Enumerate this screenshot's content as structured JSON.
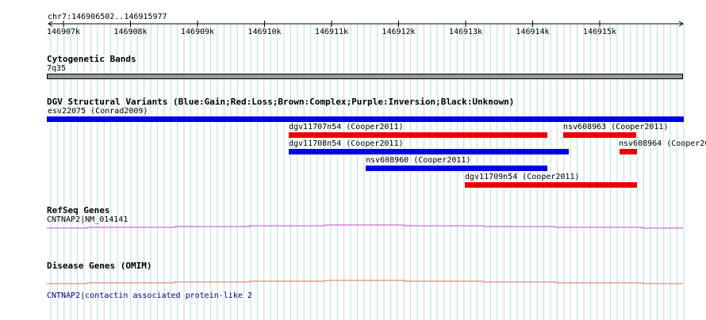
{
  "region": {
    "label": "chr7:146906502..146915977"
  },
  "ruler": {
    "ticks": [
      "146907k",
      "146908k",
      "146909k",
      "146910k",
      "146911k",
      "146912k",
      "146913k",
      "146914k",
      "146915k"
    ]
  },
  "cytogenetic": {
    "title": "Cytogenetic Bands",
    "band": "7q35",
    "color": "#999999"
  },
  "dgv": {
    "title": "DGV Structural Variants (Blue:Gain;Red:Loss;Brown:Complex;Purple:Inversion;Black:Unknown)",
    "colors": {
      "gain": "#0000e6",
      "loss": "#ee0000"
    },
    "variants": [
      {
        "label": "esv22075 (Conrad2009)",
        "type": "gain"
      },
      {
        "label": "dgv11707n54 (Cooper2011)",
        "type": "loss"
      },
      {
        "label": "nsv608963 (Cooper2011)",
        "type": "loss"
      },
      {
        "label": "dgv11708n54 (Cooper2011)",
        "type": "gain"
      },
      {
        "label": "nsv608964 (Cooper20",
        "type": "loss"
      },
      {
        "label": "nsv608960 (Cooper2011)",
        "type": "gain"
      },
      {
        "label": "dgv11709n54 (Cooper2011)",
        "type": "loss"
      }
    ]
  },
  "refseq": {
    "title": "RefSeq Genes",
    "gene": "CNTNAP2|NM_014141",
    "color": "#cc44cc"
  },
  "disease": {
    "title": "Disease Genes (OMIM)",
    "gene": "CNTNAP2|contactin associated protein-like 2",
    "color": "#e07050"
  }
}
